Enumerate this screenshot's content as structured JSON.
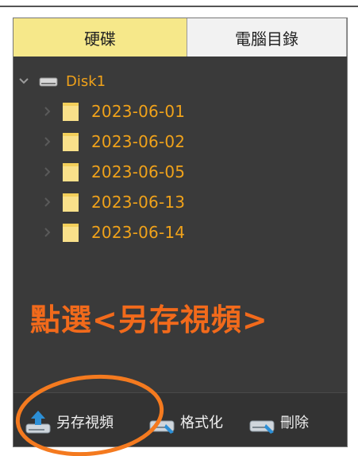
{
  "tabs": [
    {
      "label": "硬碟",
      "active": true
    },
    {
      "label": "電腦目錄",
      "active": false
    }
  ],
  "tree": {
    "disk": {
      "label": "Disk1",
      "icon": "hard-drive-icon"
    },
    "folders": [
      {
        "label": "2023-06-01"
      },
      {
        "label": "2023-06-02"
      },
      {
        "label": "2023-06-05"
      },
      {
        "label": "2023-06-13"
      },
      {
        "label": "2023-06-14"
      }
    ]
  },
  "annotation": {
    "text": "點選<另存視頻>"
  },
  "toolbar": {
    "save_as_label": "另存視頻",
    "format_label": "格式化",
    "delete_label": "刪除"
  },
  "colors": {
    "accent_tab": "#f6e88a",
    "folder_text": "#f0a21a",
    "annotation": "#f26a1b",
    "panel_bg": "#3a3a3a"
  }
}
